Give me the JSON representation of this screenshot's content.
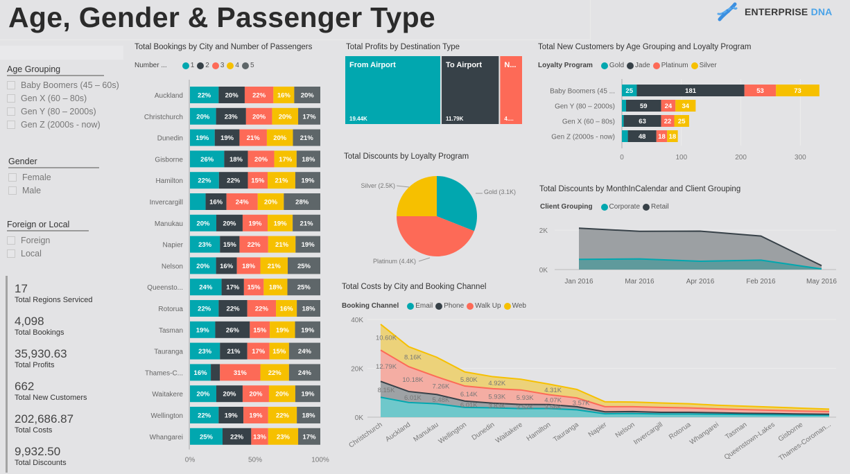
{
  "page": {
    "title": "Age, Gender & Passenger Type",
    "logo": {
      "word1": "ENTERPRISE",
      "word2": "DNA"
    }
  },
  "colors": {
    "teal": "#01A7AF",
    "dark": "#374148",
    "coral": "#FD6A57",
    "yellow": "#F6C000",
    "grey": "#5E6669",
    "background": "#E3E3E5",
    "logo_blue": "#4AA3E8"
  },
  "slicers": [
    {
      "title": "Age Grouping",
      "items": [
        "Baby Boomers (45 – 60s)",
        "Gen X (60 – 80s)",
        "Gen Y (80 – 2000s)",
        "Gen Z (2000s - now)"
      ]
    },
    {
      "title": "Gender",
      "items": [
        "Female",
        "Male"
      ]
    },
    {
      "title": "Foreign or Local",
      "items": [
        "Foreign",
        "Local"
      ]
    }
  ],
  "cards": [
    {
      "value": "17",
      "label": "Total Regions Serviced"
    },
    {
      "value": "4,098",
      "label": "Total Bookings"
    },
    {
      "value": "35,930.63",
      "label": "Total Profits"
    },
    {
      "value": "662",
      "label": "Total New Customers"
    },
    {
      "value": "202,686.87",
      "label": "Total Costs"
    },
    {
      "value": "9,932.50",
      "label": "Total Discounts"
    }
  ],
  "chart_data": [
    {
      "id": "bookings",
      "type": "bar",
      "orientation": "horizontal",
      "stacked": "100%",
      "title": "Total Bookings by City and Number of Passengers",
      "legend_title": "Number ...",
      "legend_position": "top-left",
      "series_names": [
        "1",
        "2",
        "3",
        "4",
        "5"
      ],
      "categories": [
        "Auckland",
        "Christchurch",
        "Dunedin",
        "Gisborne",
        "Hamilton",
        "Invercargill",
        "Manukau",
        "Napier",
        "Nelson",
        "Queensto...",
        "Rotorua",
        "Tasman",
        "Tauranga",
        "Thames-C...",
        "Waitakere",
        "Wellington",
        "Whangarei"
      ],
      "values": [
        [
          22,
          20,
          22,
          16,
          20
        ],
        [
          20,
          23,
          20,
          20,
          17
        ],
        [
          19,
          19,
          21,
          20,
          21
        ],
        [
          26,
          18,
          20,
          17,
          18
        ],
        [
          22,
          22,
          15,
          21,
          19
        ],
        [
          12,
          16,
          24,
          20,
          28
        ],
        [
          20,
          20,
          19,
          19,
          21
        ],
        [
          23,
          15,
          22,
          21,
          19
        ],
        [
          20,
          16,
          18,
          21,
          25
        ],
        [
          24,
          17,
          15,
          18,
          25
        ],
        [
          22,
          22,
          22,
          16,
          18
        ],
        [
          19,
          26,
          15,
          19,
          19
        ],
        [
          23,
          21,
          17,
          15,
          24
        ],
        [
          16,
          7,
          31,
          22,
          24
        ],
        [
          20,
          20,
          20,
          20,
          19
        ],
        [
          22,
          19,
          19,
          22,
          18
        ],
        [
          25,
          22,
          13,
          23,
          17
        ]
      ],
      "labels": [
        [
          "22%",
          "20%",
          "22%",
          "16%",
          "20%"
        ],
        [
          "20%",
          "23%",
          "20%",
          "20%",
          "17%"
        ],
        [
          "19%",
          "19%",
          "21%",
          "20%",
          "21%"
        ],
        [
          "26%",
          "18%",
          "20%",
          "17%",
          "18%"
        ],
        [
          "22%",
          "22%",
          "15%",
          "21%",
          "19%"
        ],
        [
          "",
          "16%",
          "24%",
          "20%",
          "28%"
        ],
        [
          "20%",
          "20%",
          "19%",
          "19%",
          "21%"
        ],
        [
          "23%",
          "15%",
          "22%",
          "21%",
          "19%"
        ],
        [
          "20%",
          "16%",
          "18%",
          "21%",
          "25%"
        ],
        [
          "24%",
          "17%",
          "15%",
          "18%",
          "25%"
        ],
        [
          "22%",
          "22%",
          "22%",
          "16%",
          "18%"
        ],
        [
          "19%",
          "26%",
          "15%",
          "19%",
          "19%"
        ],
        [
          "23%",
          "21%",
          "17%",
          "15%",
          "24%"
        ],
        [
          "16%",
          "",
          "31%",
          "22%",
          "24%"
        ],
        [
          "20%",
          "20%",
          "20%",
          "20%",
          "19%"
        ],
        [
          "22%",
          "19%",
          "19%",
          "22%",
          "18%"
        ],
        [
          "25%",
          "22%",
          "13%",
          "23%",
          "17%"
        ]
      ],
      "x_ticks": [
        "0%",
        "50%",
        "100%"
      ],
      "xlim": [
        0,
        100
      ]
    },
    {
      "id": "profits",
      "type": "treemap",
      "title": "Total Profits by Destination Type",
      "items": [
        {
          "name": "From Airport",
          "label": "From Airport",
          "value": 19440,
          "value_label": "19.44K"
        },
        {
          "name": "To Airport",
          "label": "To Airport",
          "value": 11790,
          "value_label": "11.79K"
        },
        {
          "name": "N...",
          "label": "N...",
          "value": 4700,
          "value_label": "4...."
        }
      ]
    },
    {
      "id": "discounts-loyalty",
      "type": "pie",
      "title": "Total Discounts by Loyalty Program",
      "slices": [
        {
          "name": "Gold",
          "value": 3.1,
          "label": "Gold (3.1K)"
        },
        {
          "name": "Platinum",
          "value": 4.4,
          "label": "Platinum (4.4K)"
        },
        {
          "name": "Silver",
          "value": 2.5,
          "label": "Silver (2.5K)"
        }
      ]
    },
    {
      "id": "new-customers",
      "type": "bar",
      "orientation": "horizontal",
      "stacked": true,
      "title": "Total New Customers by Age Grouping and Loyalty Program",
      "legend_title": "Loyalty Program",
      "legend_position": "top-left",
      "series_names": [
        "Gold",
        "Jade",
        "Platinum",
        "Silver"
      ],
      "categories": [
        "Baby Boomers (45 ...",
        "Gen Y (80 – 2000s)",
        "Gen X (60 – 80s)",
        "Gen Z (2000s - now)"
      ],
      "values": [
        [
          25,
          181,
          53,
          73
        ],
        [
          7,
          59,
          24,
          34
        ],
        [
          3,
          63,
          22,
          25
        ],
        [
          10,
          48,
          18,
          18
        ]
      ],
      "labels": [
        [
          "25",
          "181",
          "53",
          "73"
        ],
        [
          "",
          "59",
          "24",
          "34"
        ],
        [
          "",
          "63",
          "22",
          "25"
        ],
        [
          "",
          "48",
          "18",
          "18"
        ]
      ],
      "x_ticks": [
        0,
        100,
        200,
        300
      ],
      "xlim": [
        0,
        345
      ]
    },
    {
      "id": "discounts-month",
      "type": "area",
      "stacked": true,
      "title": "Total Discounts by MonthInCalendar and Client Grouping",
      "legend_title": "Client Grouping",
      "legend_position": "top-left",
      "x": [
        "Jan 2016",
        "Mar 2016",
        "Apr 2016",
        "Feb 2016",
        "May 2016"
      ],
      "series": [
        {
          "name": "Corporate",
          "values": [
            520,
            540,
            420,
            480,
            30
          ]
        },
        {
          "name": "Retail",
          "values": [
            1580,
            1400,
            1530,
            1220,
            170
          ]
        }
      ],
      "y_ticks": [
        "0K",
        "2K"
      ],
      "ylim": [
        0,
        2600
      ]
    },
    {
      "id": "costs",
      "type": "area",
      "stacked": true,
      "title": "Total Costs by City and Booking Channel",
      "legend_title": "Booking Channel",
      "legend_position": "top-left",
      "x": [
        "Christchurch",
        "Auckland",
        "Manukau",
        "Wellington",
        "Dunedin",
        "Waitakere",
        "Hamilton",
        "Tauranga",
        "Napier",
        "Nelson",
        "Invercargill",
        "Rotorua",
        "Whangarei",
        "Tasman",
        "Queenstown-Lakes",
        "Gisborne",
        "Thames-Coroman..."
      ],
      "series": [
        {
          "name": "Email",
          "values": [
            8150,
            6010,
            5480,
            4010,
            3830,
            3520,
            3560,
            3000,
            1400,
            1500,
            1300,
            1300,
            1200,
            1100,
            1000,
            900,
            800
          ]
        },
        {
          "name": "Phone",
          "values": [
            6500,
            4500,
            3800,
            2600,
            1900,
            1700,
            1600,
            1300,
            800,
            800,
            700,
            700,
            600,
            500,
            500,
            400,
            400
          ]
        },
        {
          "name": "Walk Up",
          "values": [
            12790,
            10180,
            7260,
            6140,
            5930,
            5930,
            4070,
            3570,
            2100,
            2000,
            2000,
            1800,
            1600,
            1500,
            1300,
            1200,
            1100
          ]
        },
        {
          "name": "Web",
          "values": [
            10600,
            8160,
            8000,
            5800,
            4920,
            4400,
            4310,
            3500,
            2000,
            1900,
            1800,
            1700,
            1500,
            1400,
            1300,
            1200,
            1000
          ]
        }
      ],
      "data_labels": [
        {
          "series": "Web",
          "values": [
            "10.60K",
            "8.16K",
            "",
            "5.80K",
            "4.92K",
            "",
            "4.31K"
          ]
        },
        {
          "series": "Walk Up",
          "values": [
            "12.79K",
            "10.18K",
            "7.26K",
            "6.14K",
            "5.93K",
            "5.93K",
            "4.07K",
            "3.57K"
          ]
        },
        {
          "series": "Phone",
          "values": [
            "8.15K",
            "6.01K",
            "5.48K",
            "6.01K",
            "3.83K",
            "3.52K",
            "3.56K"
          ]
        }
      ],
      "y_ticks": [
        "0K",
        "20K",
        "40K"
      ],
      "ylim": [
        0,
        40000
      ]
    }
  ]
}
